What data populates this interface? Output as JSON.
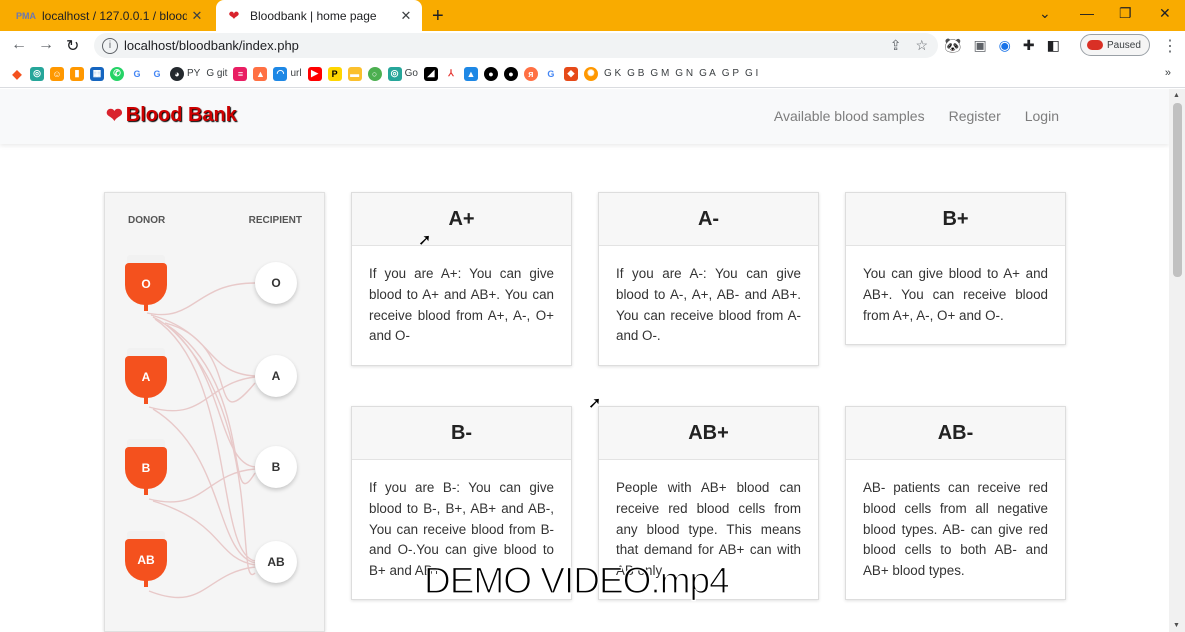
{
  "browser": {
    "tabs": [
      {
        "title": "localhost / 127.0.0.1 / bloodbank",
        "active": false,
        "favicon": "PMA"
      },
      {
        "title": "Bloodbank | home page",
        "active": true
      }
    ],
    "url": "localhost/bloodbank/index.php",
    "paused_label": "Paused",
    "bookmarks": [
      "",
      "",
      "",
      "",
      "",
      "",
      "G",
      "G",
      "",
      "PY",
      "G git",
      "",
      "",
      "url",
      "",
      "P",
      "",
      "",
      "Go",
      "",
      "",
      "",
      "",
      "",
      "",
      "G",
      "",
      "",
      "G K",
      "G B",
      "G M",
      "G N",
      "G A",
      "G P",
      "G I"
    ]
  },
  "site": {
    "brand": "Blood Bank",
    "nav": [
      "Available blood samples",
      "Register",
      "Login"
    ],
    "diagram": {
      "donor_label": "DONOR",
      "recipient_label": "RECIPIENT",
      "donors": [
        "O",
        "A",
        "B",
        "AB"
      ],
      "recipients": [
        "O",
        "A",
        "B",
        "AB"
      ]
    },
    "cards": [
      {
        "type": "A+",
        "text": "If you are A+: You can give blood to A+ and AB+. You can receive blood from A+, A-, O+ and O-"
      },
      {
        "type": "A-",
        "text": "If you are A-: You can give blood to A-, A+, AB- and AB+. You can receive blood from A- and O-."
      },
      {
        "type": "B+",
        "text": "You can give blood to A+ and AB+. You can receive blood from A+, A-, O+ and O-."
      },
      {
        "type": "B-",
        "text": "If you are B-: You can give blood to B-, B+, AB+ and AB-, You can receive blood from B- and O-.You can give blood to B+ and AB+"
      },
      {
        "type": "AB+",
        "text": "People with AB+ blood can receive red blood cells from any blood type. This means that demand for AB+ can with AB only."
      },
      {
        "type": "AB-",
        "text": "AB- patients can receive red blood cells from all negative blood types. AB- can give red blood cells to both AB- and AB+ blood types."
      }
    ]
  },
  "overlay": {
    "watermark": "DEMO VIDEO.mp4"
  }
}
